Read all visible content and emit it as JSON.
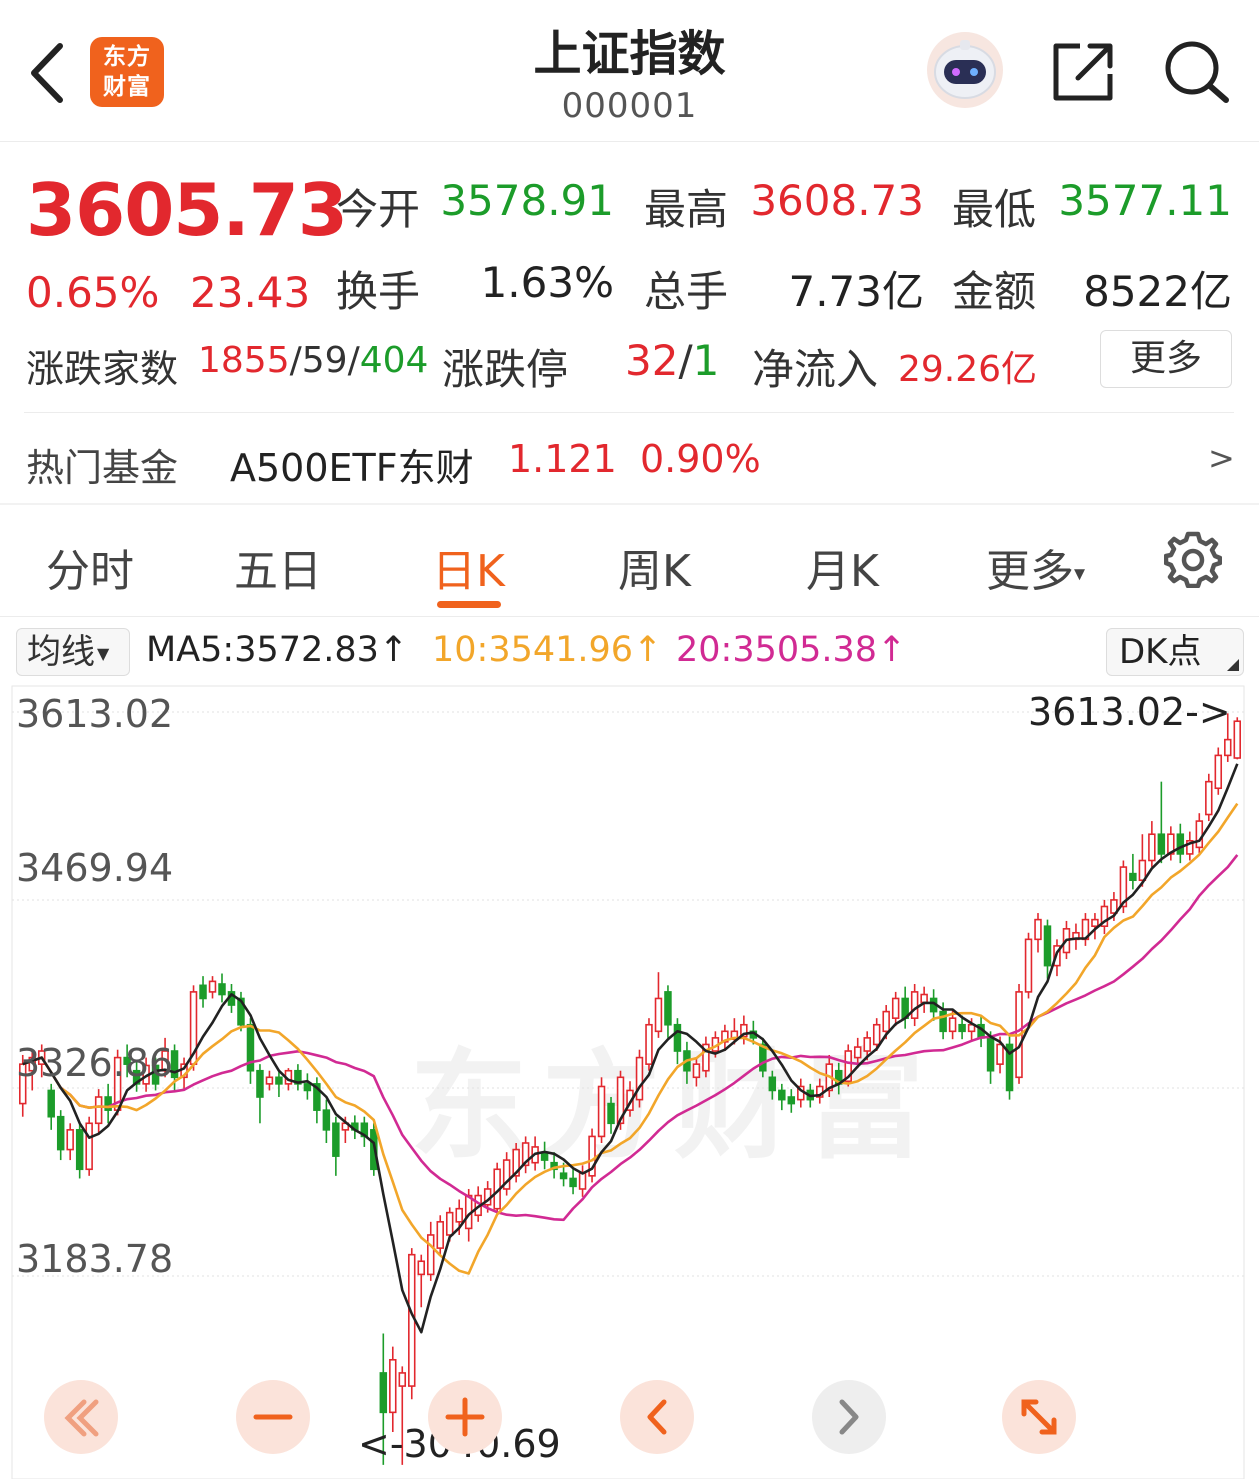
{
  "header": {
    "title": "上证指数",
    "code": "000001",
    "logo_line1": "东方",
    "logo_line2": "财富"
  },
  "quote": {
    "price": "3605.73",
    "change_pct": "0.65%",
    "change": "23.43",
    "open_label": "今开",
    "open": "3578.91",
    "high_label": "最高",
    "high": "3608.73",
    "low_label": "最低",
    "low": "3577.11",
    "turnover_label": "换手",
    "turnover": "1.63%",
    "volume_label": "总手",
    "volume": "7.73亿",
    "amount_label": "金额",
    "amount": "8522亿",
    "breadth_label": "涨跌家数",
    "breadth_up": "1855",
    "breadth_flat": "59",
    "breadth_down": "404",
    "limit_label": "涨跌停",
    "limit_up": "32",
    "limit_down": "1",
    "inflow_label": "净流入",
    "inflow": "29.26亿",
    "more_label": "更多"
  },
  "fund": {
    "label": "热门基金",
    "name": "A500ETF东财",
    "price": "1.121",
    "pct": "0.90%",
    "arrow": ">"
  },
  "tabs": [
    {
      "label": "分时"
    },
    {
      "label": "五日"
    },
    {
      "label": "日K"
    },
    {
      "label": "周K"
    },
    {
      "label": "月K"
    },
    {
      "label": "更多"
    }
  ],
  "active_tab": "日K",
  "ma_bar": {
    "selector_label": "均线",
    "ma5": "MA5:3572.83↑",
    "ma10": "10:3541.96↑",
    "ma20": "20:3505.38↑",
    "dk_label": "DK点"
  },
  "colors": {
    "up": "#e2282e",
    "down": "#1c9c2a",
    "accent": "#f0621d",
    "ma5": "#222222",
    "ma10": "#f2a62a",
    "ma20": "#d12a93"
  },
  "icons": [
    "back-icon",
    "robot-icon",
    "share-icon",
    "search-icon",
    "gear-icon",
    "rewind-icon",
    "zoom-out-icon",
    "zoom-in-icon",
    "left-icon",
    "right-icon",
    "expand-icon"
  ],
  "chart_data": {
    "type": "candlestick",
    "y_ticks": [
      "3613.02",
      "3469.94",
      "3326.86",
      "3183.78"
    ],
    "ylim": [
      3040.69,
      3613.02
    ],
    "max_annotation": "3613.02->",
    "min_annotation": "<-3040.69",
    "watermark": "东方财富",
    "candles": [
      {
        "o": 3315,
        "c": 3345,
        "h": 3352,
        "l": 3305
      },
      {
        "o": 3340,
        "c": 3350,
        "h": 3356,
        "l": 3325
      },
      {
        "o": 3345,
        "c": 3355,
        "h": 3360,
        "l": 3335
      },
      {
        "o": 3325,
        "c": 3305,
        "h": 3330,
        "l": 3295
      },
      {
        "o": 3305,
        "c": 3280,
        "h": 3310,
        "l": 3272
      },
      {
        "o": 3280,
        "c": 3295,
        "h": 3300,
        "l": 3272
      },
      {
        "o": 3295,
        "c": 3265,
        "h": 3300,
        "l": 3258
      },
      {
        "o": 3265,
        "c": 3300,
        "h": 3305,
        "l": 3260
      },
      {
        "o": 3300,
        "c": 3320,
        "h": 3326,
        "l": 3292
      },
      {
        "o": 3320,
        "c": 3310,
        "h": 3330,
        "l": 3300
      },
      {
        "o": 3310,
        "c": 3350,
        "h": 3356,
        "l": 3306
      },
      {
        "o": 3350,
        "c": 3345,
        "h": 3360,
        "l": 3335
      },
      {
        "o": 3340,
        "c": 3330,
        "h": 3348,
        "l": 3324
      },
      {
        "o": 3330,
        "c": 3344,
        "h": 3350,
        "l": 3324
      },
      {
        "o": 3344,
        "c": 3330,
        "h": 3350,
        "l": 3325
      },
      {
        "o": 3340,
        "c": 3355,
        "h": 3365,
        "l": 3335
      },
      {
        "o": 3355,
        "c": 3335,
        "h": 3360,
        "l": 3325
      },
      {
        "o": 3335,
        "c": 3345,
        "h": 3350,
        "l": 3325
      },
      {
        "o": 3345,
        "c": 3400,
        "h": 3405,
        "l": 3340
      },
      {
        "o": 3405,
        "c": 3395,
        "h": 3412,
        "l": 3388
      },
      {
        "o": 3400,
        "c": 3408,
        "h": 3412,
        "l": 3395
      },
      {
        "o": 3406,
        "c": 3398,
        "h": 3414,
        "l": 3392
      },
      {
        "o": 3400,
        "c": 3390,
        "h": 3406,
        "l": 3384
      },
      {
        "o": 3395,
        "c": 3375,
        "h": 3400,
        "l": 3370
      },
      {
        "o": 3375,
        "c": 3340,
        "h": 3380,
        "l": 3330
      },
      {
        "o": 3340,
        "c": 3320,
        "h": 3345,
        "l": 3300
      },
      {
        "o": 3330,
        "c": 3335,
        "h": 3340,
        "l": 3325
      },
      {
        "o": 3335,
        "c": 3330,
        "h": 3340,
        "l": 3320
      },
      {
        "o": 3330,
        "c": 3340,
        "h": 3342,
        "l": 3325
      },
      {
        "o": 3340,
        "c": 3330,
        "h": 3345,
        "l": 3325
      },
      {
        "o": 3330,
        "c": 3325,
        "h": 3338,
        "l": 3318
      },
      {
        "o": 3330,
        "c": 3310,
        "h": 3335,
        "l": 3300
      },
      {
        "o": 3310,
        "c": 3295,
        "h": 3318,
        "l": 3285
      },
      {
        "o": 3300,
        "c": 3275,
        "h": 3305,
        "l": 3260
      },
      {
        "o": 3295,
        "c": 3300,
        "h": 3305,
        "l": 3285
      },
      {
        "o": 3300,
        "c": 3295,
        "h": 3306,
        "l": 3288
      },
      {
        "o": 3300,
        "c": 3290,
        "h": 3305,
        "l": 3282
      },
      {
        "o": 3295,
        "c": 3265,
        "h": 3300,
        "l": 3260
      },
      {
        "o": 3110,
        "c": 3080,
        "h": 3140,
        "l": 3040
      },
      {
        "o": 3080,
        "c": 3120,
        "h": 3130,
        "l": 3065
      },
      {
        "o": 3100,
        "c": 3110,
        "h": 3115,
        "l": 3040
      },
      {
        "o": 3100,
        "c": 3200,
        "h": 3205,
        "l": 3090
      },
      {
        "o": 3185,
        "c": 3195,
        "h": 3200,
        "l": 3160
      },
      {
        "o": 3185,
        "c": 3215,
        "h": 3225,
        "l": 3180
      },
      {
        "o": 3205,
        "c": 3225,
        "h": 3230,
        "l": 3200
      },
      {
        "o": 3215,
        "c": 3232,
        "h": 3236,
        "l": 3210
      },
      {
        "o": 3225,
        "c": 3235,
        "h": 3242,
        "l": 3215
      },
      {
        "o": 3220,
        "c": 3245,
        "h": 3250,
        "l": 3210
      },
      {
        "o": 3230,
        "c": 3245,
        "h": 3252,
        "l": 3225
      },
      {
        "o": 3238,
        "c": 3250,
        "h": 3256,
        "l": 3232
      },
      {
        "o": 3235,
        "c": 3265,
        "h": 3270,
        "l": 3230
      },
      {
        "o": 3250,
        "c": 3272,
        "h": 3278,
        "l": 3245
      },
      {
        "o": 3260,
        "c": 3280,
        "h": 3285,
        "l": 3255
      },
      {
        "o": 3268,
        "c": 3285,
        "h": 3290,
        "l": 3262
      },
      {
        "o": 3270,
        "c": 3282,
        "h": 3290,
        "l": 3264
      },
      {
        "o": 3278,
        "c": 3272,
        "h": 3286,
        "l": 3265
      },
      {
        "o": 3270,
        "c": 3265,
        "h": 3278,
        "l": 3258
      },
      {
        "o": 3262,
        "c": 3258,
        "h": 3270,
        "l": 3252
      },
      {
        "o": 3258,
        "c": 3252,
        "h": 3265,
        "l": 3246
      },
      {
        "o": 3250,
        "c": 3262,
        "h": 3268,
        "l": 3244
      },
      {
        "o": 3260,
        "c": 3290,
        "h": 3296,
        "l": 3255
      },
      {
        "o": 3290,
        "c": 3328,
        "h": 3335,
        "l": 3285
      },
      {
        "o": 3315,
        "c": 3300,
        "h": 3320,
        "l": 3292
      },
      {
        "o": 3300,
        "c": 3335,
        "h": 3340,
        "l": 3295
      },
      {
        "o": 3310,
        "c": 3325,
        "h": 3332,
        "l": 3305
      },
      {
        "o": 3318,
        "c": 3350,
        "h": 3356,
        "l": 3312
      },
      {
        "o": 3345,
        "c": 3375,
        "h": 3380,
        "l": 3340
      },
      {
        "o": 3370,
        "c": 3395,
        "h": 3415,
        "l": 3365
      },
      {
        "o": 3400,
        "c": 3375,
        "h": 3405,
        "l": 3365
      },
      {
        "o": 3375,
        "c": 3355,
        "h": 3380,
        "l": 3345
      },
      {
        "o": 3355,
        "c": 3340,
        "h": 3362,
        "l": 3330
      },
      {
        "o": 3335,
        "c": 3345,
        "h": 3350,
        "l": 3328
      },
      {
        "o": 3340,
        "c": 3360,
        "h": 3366,
        "l": 3335
      },
      {
        "o": 3355,
        "c": 3365,
        "h": 3370,
        "l": 3350
      },
      {
        "o": 3362,
        "c": 3370,
        "h": 3375,
        "l": 3355
      },
      {
        "o": 3364,
        "c": 3370,
        "h": 3380,
        "l": 3360
      },
      {
        "o": 3366,
        "c": 3375,
        "h": 3382,
        "l": 3360
      },
      {
        "o": 3370,
        "c": 3365,
        "h": 3378,
        "l": 3360
      },
      {
        "o": 3360,
        "c": 3340,
        "h": 3365,
        "l": 3335
      },
      {
        "o": 3335,
        "c": 3325,
        "h": 3340,
        "l": 3318
      },
      {
        "o": 3325,
        "c": 3318,
        "h": 3330,
        "l": 3310
      },
      {
        "o": 3320,
        "c": 3315,
        "h": 3326,
        "l": 3308
      },
      {
        "o": 3318,
        "c": 3328,
        "h": 3334,
        "l": 3312
      },
      {
        "o": 3325,
        "c": 3318,
        "h": 3330,
        "l": 3312
      },
      {
        "o": 3320,
        "c": 3328,
        "h": 3334,
        "l": 3315
      },
      {
        "o": 3325,
        "c": 3345,
        "h": 3352,
        "l": 3320
      },
      {
        "o": 3340,
        "c": 3330,
        "h": 3346,
        "l": 3322
      },
      {
        "o": 3332,
        "c": 3355,
        "h": 3360,
        "l": 3328
      },
      {
        "o": 3350,
        "c": 3358,
        "h": 3365,
        "l": 3342
      },
      {
        "o": 3355,
        "c": 3365,
        "h": 3370,
        "l": 3348
      },
      {
        "o": 3360,
        "c": 3375,
        "h": 3380,
        "l": 3355
      },
      {
        "o": 3370,
        "c": 3385,
        "h": 3390,
        "l": 3364
      },
      {
        "o": 3380,
        "c": 3395,
        "h": 3400,
        "l": 3374
      },
      {
        "o": 3395,
        "c": 3380,
        "h": 3404,
        "l": 3372
      },
      {
        "o": 3380,
        "c": 3400,
        "h": 3406,
        "l": 3374
      },
      {
        "o": 3392,
        "c": 3398,
        "h": 3404,
        "l": 3384
      },
      {
        "o": 3395,
        "c": 3385,
        "h": 3402,
        "l": 3378
      },
      {
        "o": 3385,
        "c": 3370,
        "h": 3392,
        "l": 3364
      },
      {
        "o": 3370,
        "c": 3380,
        "h": 3386,
        "l": 3364
      },
      {
        "o": 3375,
        "c": 3370,
        "h": 3382,
        "l": 3364
      },
      {
        "o": 3370,
        "c": 3375,
        "h": 3380,
        "l": 3362
      },
      {
        "o": 3375,
        "c": 3365,
        "h": 3382,
        "l": 3358
      },
      {
        "o": 3365,
        "c": 3340,
        "h": 3370,
        "l": 3330
      },
      {
        "o": 3345,
        "c": 3360,
        "h": 3366,
        "l": 3338
      },
      {
        "o": 3360,
        "c": 3325,
        "h": 3366,
        "l": 3318
      },
      {
        "o": 3335,
        "c": 3400,
        "h": 3406,
        "l": 3330
      },
      {
        "o": 3400,
        "c": 3440,
        "h": 3445,
        "l": 3395
      },
      {
        "o": 3440,
        "c": 3455,
        "h": 3460,
        "l": 3430
      },
      {
        "o": 3450,
        "c": 3420,
        "h": 3455,
        "l": 3410
      },
      {
        "o": 3420,
        "c": 3435,
        "h": 3440,
        "l": 3412
      },
      {
        "o": 3430,
        "c": 3448,
        "h": 3454,
        "l": 3425
      },
      {
        "o": 3440,
        "c": 3445,
        "h": 3452,
        "l": 3432
      },
      {
        "o": 3440,
        "c": 3455,
        "h": 3460,
        "l": 3435
      },
      {
        "o": 3450,
        "c": 3455,
        "h": 3460,
        "l": 3440
      },
      {
        "o": 3450,
        "c": 3465,
        "h": 3470,
        "l": 3444
      },
      {
        "o": 3460,
        "c": 3470,
        "h": 3476,
        "l": 3454
      },
      {
        "o": 3465,
        "c": 3495,
        "h": 3500,
        "l": 3460
      },
      {
        "o": 3490,
        "c": 3485,
        "h": 3505,
        "l": 3478
      },
      {
        "o": 3485,
        "c": 3500,
        "h": 3520,
        "l": 3480
      },
      {
        "o": 3500,
        "c": 3520,
        "h": 3530,
        "l": 3495
      },
      {
        "o": 3520,
        "c": 3505,
        "h": 3560,
        "l": 3498
      },
      {
        "o": 3505,
        "c": 3520,
        "h": 3526,
        "l": 3500
      },
      {
        "o": 3520,
        "c": 3505,
        "h": 3528,
        "l": 3498
      },
      {
        "o": 3505,
        "c": 3515,
        "h": 3522,
        "l": 3500
      },
      {
        "o": 3510,
        "c": 3530,
        "h": 3536,
        "l": 3505
      },
      {
        "o": 3535,
        "c": 3560,
        "h": 3566,
        "l": 3530
      },
      {
        "o": 3555,
        "c": 3580,
        "h": 3586,
        "l": 3550
      },
      {
        "o": 3580,
        "c": 3592,
        "h": 3612,
        "l": 3575
      },
      {
        "o": 3578,
        "c": 3606,
        "h": 3609,
        "l": 3577
      }
    ]
  }
}
